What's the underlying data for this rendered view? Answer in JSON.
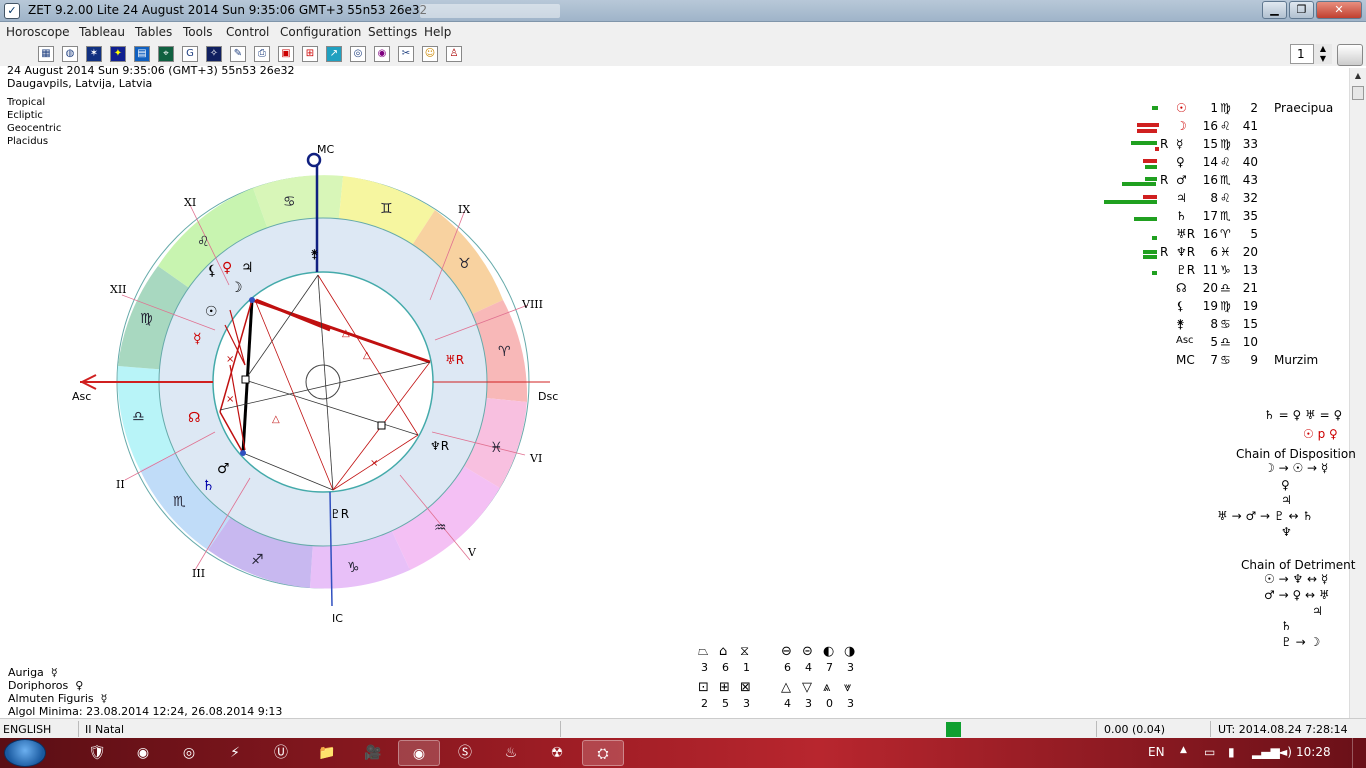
{
  "window": {
    "title": "ZET 9.2.00 Lite   24 August 2014   Sun    9:35:06 GMT+3 55n53  26e32",
    "min": "▁",
    "max": "❐",
    "close": "✕"
  },
  "menu": [
    "Horoscope",
    "Tableau",
    "Tables",
    "Tools",
    "Control",
    "Configuration",
    "Settings",
    "Help"
  ],
  "toolbar": {
    "page_value": "1"
  },
  "header": {
    "line1": "24 August 2014   Sun    9:35:06 (GMT+3) 55n53  26e32",
    "line2": "Daugavpils, Latvija, Latvia"
  },
  "chart_settings": [
    "Tropical",
    "Ecliptic",
    "Geocentric",
    "Placidus"
  ],
  "wheel": {
    "mc": "MC",
    "ic": "IC",
    "asc": "Asc",
    "dsc": "Dsc",
    "houses": [
      "XI",
      "IX",
      "XII",
      "VIII",
      "II",
      "VI",
      "III",
      "V"
    ],
    "signs": [
      "♋",
      "♊",
      "♉",
      "♈",
      "♓",
      "♒",
      "♑",
      "♐",
      "♏",
      "♎",
      "♍",
      "♌"
    ],
    "planets": [
      {
        "glyph": "⚸",
        "color": "#000"
      },
      {
        "glyph": "♀",
        "color": "#c00"
      },
      {
        "glyph": "♃",
        "color": "#000"
      },
      {
        "glyph": "☽",
        "color": "#000"
      },
      {
        "glyph": "☉",
        "color": "#000"
      },
      {
        "glyph": "☿",
        "color": "#c00"
      },
      {
        "glyph": "☊",
        "color": "#c00"
      },
      {
        "glyph": "♂",
        "color": "#000"
      },
      {
        "glyph": "♄",
        "color": "#00a"
      },
      {
        "glyph": "♅R",
        "color": "#c00"
      },
      {
        "glyph": "♆R",
        "color": "#000"
      },
      {
        "glyph": "♇R",
        "color": "#000"
      },
      {
        "glyph": "⚵",
        "color": "#000"
      }
    ]
  },
  "positions": [
    {
      "r": "",
      "glyph": "☉",
      "color": "#c00",
      "deg": "1",
      "sign": "♍",
      "min": "2",
      "note": "Praecipua"
    },
    {
      "r": "",
      "glyph": "☽",
      "color": "#c00",
      "deg": "16",
      "sign": "♌",
      "min": "41",
      "note": ""
    },
    {
      "r": "R",
      "glyph": "☿",
      "color": "#000",
      "deg": "15",
      "sign": "♍",
      "min": "33",
      "note": ""
    },
    {
      "r": "",
      "glyph": "♀",
      "color": "#000",
      "deg": "14",
      "sign": "♌",
      "min": "40",
      "note": ""
    },
    {
      "r": "R",
      "glyph": "♂",
      "color": "#000",
      "deg": "16",
      "sign": "♏",
      "min": "43",
      "note": ""
    },
    {
      "r": "",
      "glyph": "♃",
      "color": "#000",
      "deg": "8",
      "sign": "♌",
      "min": "32",
      "note": ""
    },
    {
      "r": "",
      "glyph": "♄",
      "color": "#000",
      "deg": "17",
      "sign": "♏",
      "min": "35",
      "note": ""
    },
    {
      "r": "",
      "glyph": "♅R",
      "color": "#000",
      "deg": "16",
      "sign": "♈",
      "min": "5",
      "note": ""
    },
    {
      "r": "R",
      "glyph": "♆R",
      "color": "#000",
      "deg": "6",
      "sign": "♓",
      "min": "20",
      "note": ""
    },
    {
      "r": "",
      "glyph": "♇R",
      "color": "#000",
      "deg": "11",
      "sign": "♑",
      "min": "13",
      "note": ""
    },
    {
      "r": "",
      "glyph": "☊",
      "color": "#000",
      "deg": "20",
      "sign": "♎",
      "min": "21",
      "note": ""
    },
    {
      "r": "",
      "glyph": "⚸",
      "color": "#000",
      "deg": "19",
      "sign": "♍",
      "min": "19",
      "note": ""
    },
    {
      "r": "",
      "glyph": "⚵",
      "color": "#000",
      "deg": "8",
      "sign": "♋",
      "min": "15",
      "note": ""
    },
    {
      "r": "",
      "glyph": "Asc",
      "color": "#000",
      "deg": "5",
      "sign": "♎",
      "min": "10",
      "note": ""
    },
    {
      "r": "",
      "glyph": "MC",
      "color": "#000",
      "deg": "7",
      "sign": "♋",
      "min": "9",
      "note": "Murzim"
    }
  ],
  "receptions": {
    "line1": "♄ = ♀ ♅ = ♀",
    "line2": "☉ p ♀"
  },
  "chain_disposition": {
    "title": "Chain of Disposition",
    "lines": [
      "☽ → ☉ → ☿",
      "♀",
      "♃",
      "♅ → ♂ → ♇ ↔ ♄",
      "♆"
    ]
  },
  "chain_detriment": {
    "title": "Chain of Detriment",
    "lines": [
      "☉ → ♆ ↔ ☿",
      "♂ → ♀ ↔ ♅",
      "♃",
      "♄",
      "♇ → ☽"
    ]
  },
  "bottom_left": {
    "auriga": "Auriga",
    "auriga_glyph": "☿",
    "doriphoros": "Doriphoros",
    "doriphoros_glyph": "♀",
    "almuten": "Almuten Figuris",
    "almuten_glyph": "☿",
    "algol": "Algol Minima: 23.08.2014 12:24,  26.08.2014  9:13"
  },
  "stats": {
    "quadruplicity": [
      {
        "icon": "⏢",
        "value": "3"
      },
      {
        "icon": "⌂",
        "value": "6"
      },
      {
        "icon": "⧖",
        "value": "1"
      }
    ],
    "elements": [
      {
        "icon": "⊖",
        "value": "6"
      },
      {
        "icon": "⊝",
        "value": "4"
      },
      {
        "icon": "◐",
        "value": "7"
      },
      {
        "icon": "◑",
        "value": "3"
      }
    ],
    "squares": [
      {
        "icon": "⊡",
        "value": "2"
      },
      {
        "icon": "⊞",
        "value": "5"
      },
      {
        "icon": "⊠",
        "value": "3"
      }
    ],
    "triangles": [
      {
        "icon": "△",
        "value": "4"
      },
      {
        "icon": "▽",
        "value": "3"
      },
      {
        "icon": "⩓",
        "value": "0"
      },
      {
        "icon": "⩔",
        "value": "3"
      }
    ]
  },
  "status": {
    "language": "ENGLISH",
    "mode": "II Natal",
    "value": "0.00 (0.04)",
    "ut": "UT: 2014.08.24   7:28:14"
  },
  "taskbar": {
    "lang": "EN",
    "time": "10:28",
    "apps": [
      "🛡",
      "◉",
      "◎",
      "⚡",
      "Ⓤ",
      "📁",
      "🎥",
      "◉",
      "Ⓢ",
      "♨",
      "☢",
      "⛭"
    ]
  }
}
